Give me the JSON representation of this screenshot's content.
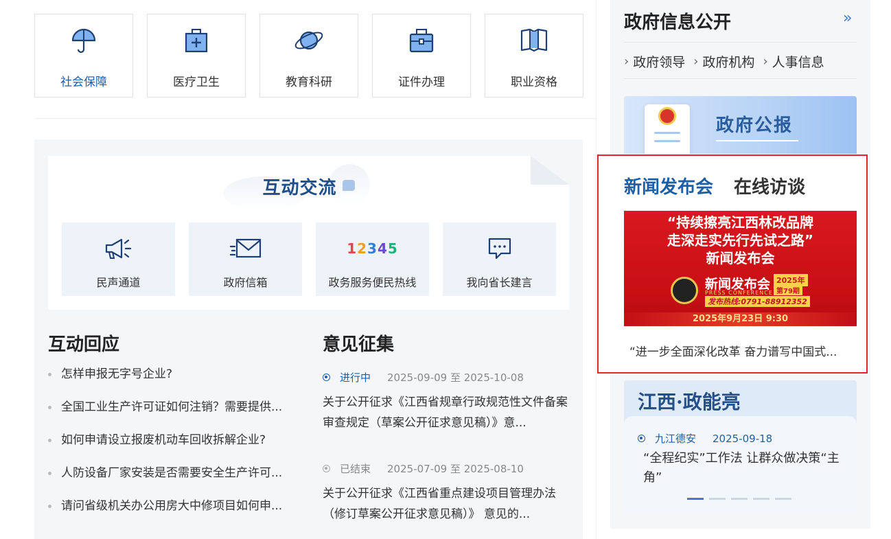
{
  "services": [
    {
      "label": "社会保障",
      "icon": "umbrella-icon"
    },
    {
      "label": "医疗卫生",
      "icon": "medical-kit-icon"
    },
    {
      "label": "教育科研",
      "icon": "planet-icon"
    },
    {
      "label": "证件办理",
      "icon": "briefcase-icon"
    },
    {
      "label": "职业资格",
      "icon": "book-icon"
    }
  ],
  "interaction": {
    "title": "互动交流",
    "channels": [
      {
        "label": "民声通道",
        "icon": "megaphone-icon"
      },
      {
        "label": "政府信箱",
        "icon": "mail-icon"
      },
      {
        "label": "政务服务便民热线",
        "icon": "hotline-12345-icon",
        "number": "12345"
      },
      {
        "label": "我向省长建言",
        "icon": "chat-icon"
      }
    ]
  },
  "response": {
    "title": "互动回应",
    "items": [
      "怎样申报无字号企业?",
      "全国工业生产许可证如何注销？需要提供...",
      "如何申请设立报废机动车回收拆解企业?",
      "人防设备厂家安装是否需要安全生产许可...",
      "请问省级机关办公用房大中修项目如何申..."
    ]
  },
  "opinions": {
    "title": "意见征集",
    "items": [
      {
        "status": "进行中",
        "date": "2025-09-09 至 2025-10-08",
        "text": "关于公开征求《江西省规章行政规范性文件备案审查规定（草案公开征求意见稿）》意..."
      },
      {
        "status": "已结束",
        "date": "2025-07-09 至 2025-08-10",
        "text": "关于公开征求《江西省重点建设项目管理办法（修订草案公开征求意见稿）》 意见的..."
      }
    ]
  },
  "gov_info": {
    "title": "政府信息公开",
    "more": "»",
    "links": [
      "政府领导",
      "政府机构",
      "人事信息"
    ],
    "bulletin": "政府公报"
  },
  "news": {
    "tabs": [
      "新闻发布会",
      "在线访谈"
    ],
    "poster": {
      "line1": "“持续擦亮江西林改品牌",
      "line2": "走深走实先行先试之路”",
      "line3": "新闻发布会",
      "brand": "新闻发布会",
      "brand_en": "PRESS CONFERENCE",
      "year": "2025年",
      "issue": "第79期",
      "hotline": "发布热线:0791-88912352",
      "date": "2025年9月23日  9:30"
    },
    "caption": "“进一步全面深化改革 奋力谱写中国式..."
  },
  "jiangxi": {
    "title": "江西·政能亮",
    "source": "九江德安",
    "date": "2025-09-18",
    "text": "“全程纪实”工作法 让群众做决策“主角”",
    "slides": 5,
    "active_slide": 1
  },
  "colors": {
    "accent": "#1d5fa6",
    "highlight_border": "#e3262c",
    "poster_red": "#d9191f"
  }
}
